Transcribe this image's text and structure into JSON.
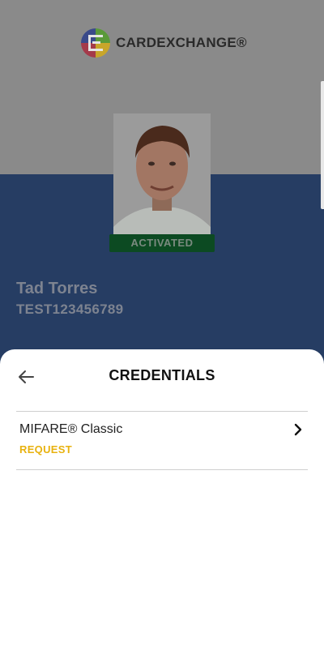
{
  "brand": {
    "name": "CARDEXCHANGE®"
  },
  "card": {
    "status": "ACTIVATED",
    "holder_name": "Tad Torres",
    "holder_id": "TEST123456789"
  },
  "sheet": {
    "title": "CREDENTIALS",
    "items": [
      {
        "name": "MIFARE® Classic",
        "action": "REQUEST"
      }
    ]
  },
  "colors": {
    "card_blue": "#263d63",
    "status_green": "#0c4a22",
    "request_yellow": "#e8b20f"
  },
  "icons": {
    "back": "arrow-left-icon",
    "open": "chevron-right-icon",
    "logo": "cardexchange-logo-icon"
  }
}
